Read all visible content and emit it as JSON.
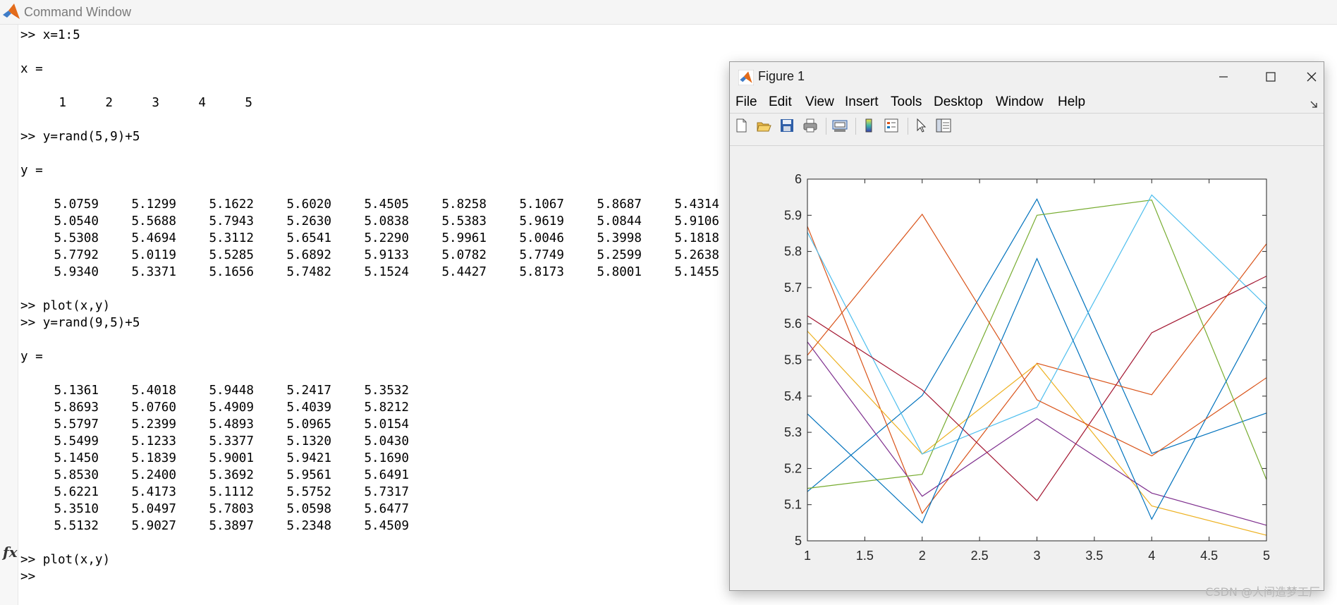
{
  "command_window": {
    "title": "Command Window",
    "lines": [
      ">> x=1:5",
      "x =",
      ">> y=rand(5,9)+5",
      "y =",
      ">> plot(x,y)",
      ">> y=rand(9,5)+5",
      "y =",
      ">> plot(x,y)",
      ">>"
    ],
    "x_row": [
      "1",
      "2",
      "3",
      "4",
      "5"
    ],
    "matrix1": [
      [
        "5.0759",
        "5.1299",
        "5.1622",
        "5.6020",
        "5.4505",
        "5.8258",
        "5.1067",
        "5.8687",
        "5.4314"
      ],
      [
        "5.0540",
        "5.5688",
        "5.7943",
        "5.2630",
        "5.0838",
        "5.5383",
        "5.9619",
        "5.0844",
        "5.9106"
      ],
      [
        "5.5308",
        "5.4694",
        "5.3112",
        "5.6541",
        "5.2290",
        "5.9961",
        "5.0046",
        "5.3998",
        "5.1818"
      ],
      [
        "5.7792",
        "5.0119",
        "5.5285",
        "5.6892",
        "5.9133",
        "5.0782",
        "5.7749",
        "5.2599",
        "5.2638"
      ],
      [
        "5.9340",
        "5.3371",
        "5.1656",
        "5.7482",
        "5.1524",
        "5.4427",
        "5.8173",
        "5.8001",
        "5.1455"
      ]
    ],
    "matrix2": [
      [
        "5.1361",
        "5.4018",
        "5.9448",
        "5.2417",
        "5.3532"
      ],
      [
        "5.8693",
        "5.0760",
        "5.4909",
        "5.4039",
        "5.8212"
      ],
      [
        "5.5797",
        "5.2399",
        "5.4893",
        "5.0965",
        "5.0154"
      ],
      [
        "5.5499",
        "5.1233",
        "5.3377",
        "5.1320",
        "5.0430"
      ],
      [
        "5.1450",
        "5.1839",
        "5.9001",
        "5.9421",
        "5.1690"
      ],
      [
        "5.8530",
        "5.2400",
        "5.3692",
        "5.9561",
        "5.6491"
      ],
      [
        "5.6221",
        "5.4173",
        "5.1112",
        "5.5752",
        "5.7317"
      ],
      [
        "5.3510",
        "5.0497",
        "5.7803",
        "5.0598",
        "5.6477"
      ],
      [
        "5.5132",
        "5.9027",
        "5.3897",
        "5.2348",
        "5.4509"
      ]
    ],
    "fx_label": "fx"
  },
  "figure": {
    "title": "Figure 1",
    "menu": [
      "File",
      "Edit",
      "View",
      "Insert",
      "Tools",
      "Desktop",
      "Window",
      "Help"
    ],
    "toolbar_icons": [
      "new-figure-icon",
      "open-file-icon",
      "save-icon",
      "print-icon",
      "print-preview-icon",
      "colorbar-icon",
      "legend-icon",
      "pointer-icon",
      "property-inspector-icon"
    ],
    "window_buttons": [
      "minimize-icon",
      "maximize-icon",
      "close-icon"
    ]
  },
  "chart_data": {
    "type": "line",
    "x": [
      1,
      2,
      3,
      4,
      5
    ],
    "xlim": [
      1,
      5
    ],
    "ylim": [
      5,
      6
    ],
    "xticks": [
      "1",
      "1.5",
      "2",
      "2.5",
      "3",
      "3.5",
      "4",
      "4.5",
      "5"
    ],
    "yticks": [
      "5",
      "5.1",
      "5.2",
      "5.3",
      "5.4",
      "5.5",
      "5.6",
      "5.7",
      "5.8",
      "5.9",
      "6"
    ],
    "grid": false,
    "series": [
      {
        "color": "#0072BD",
        "values": [
          5.1361,
          5.4018,
          5.9448,
          5.2417,
          5.3532
        ]
      },
      {
        "color": "#D95319",
        "values": [
          5.8693,
          5.076,
          5.4909,
          5.4039,
          5.8212
        ]
      },
      {
        "color": "#EDB120",
        "values": [
          5.5797,
          5.2399,
          5.4893,
          5.0965,
          5.0154
        ]
      },
      {
        "color": "#7E2F8E",
        "values": [
          5.5499,
          5.1233,
          5.3377,
          5.132,
          5.043
        ]
      },
      {
        "color": "#77AC30",
        "values": [
          5.145,
          5.1839,
          5.9001,
          5.9421,
          5.169
        ]
      },
      {
        "color": "#4DBEEE",
        "values": [
          5.853,
          5.24,
          5.3692,
          5.9561,
          5.6491
        ]
      },
      {
        "color": "#A2142F",
        "values": [
          5.6221,
          5.4173,
          5.1112,
          5.5752,
          5.7317
        ]
      },
      {
        "color": "#0072BD",
        "values": [
          5.351,
          5.0497,
          5.7803,
          5.0598,
          5.6477
        ]
      },
      {
        "color": "#D95319",
        "values": [
          5.5132,
          5.9027,
          5.3897,
          5.2348,
          5.4509
        ]
      }
    ]
  },
  "watermark": "CSDN @人间造梦工厂"
}
